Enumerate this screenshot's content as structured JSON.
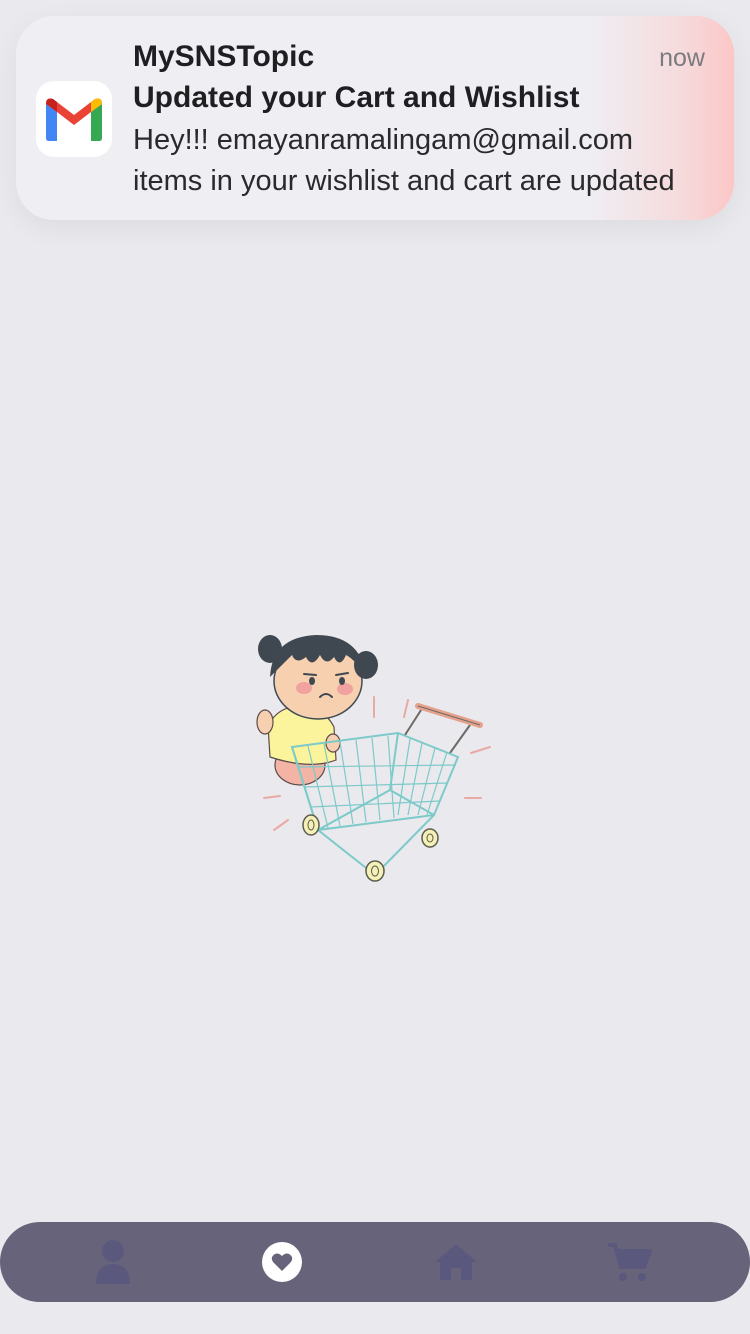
{
  "notification": {
    "app_name": "MySNSTopic",
    "time": "now",
    "title": "Updated your Cart and Wishlist",
    "body_line1": "Hey!!! emayanramalingam@gmail.com",
    "body_line2": "items in your wishlist and cart are updated",
    "app_icon": "gmail-icon"
  },
  "illustration": {
    "subject": "sad-girl-with-empty-shopping-cart"
  },
  "bottom_nav": {
    "items": [
      {
        "icon": "profile-icon",
        "active": false
      },
      {
        "icon": "heart-icon",
        "active": true
      },
      {
        "icon": "home-icon",
        "active": false
      },
      {
        "icon": "cart-icon",
        "active": false
      }
    ],
    "background_color": "#66637A",
    "inactive_icon_color": "#5B587E",
    "active_icon_color": "#FFFFFF"
  },
  "colors": {
    "page_background": "#EAE9EE"
  }
}
